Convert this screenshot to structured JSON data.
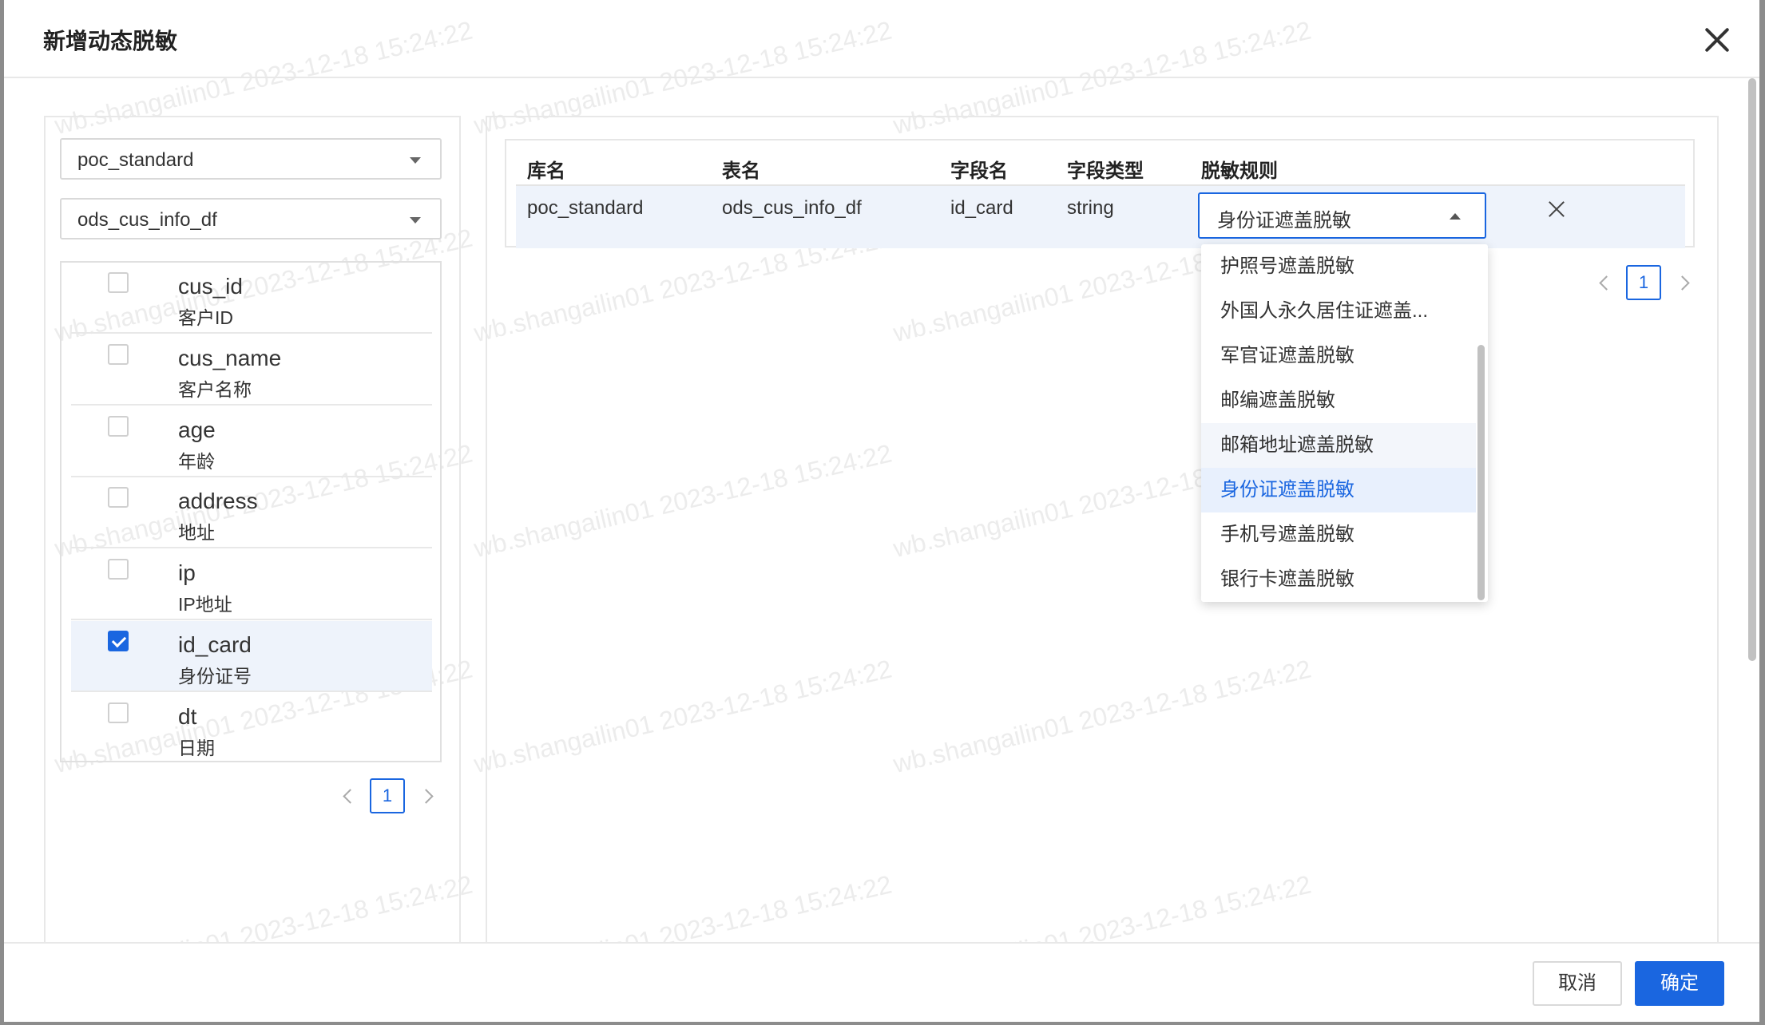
{
  "modal": {
    "title": "新增动态脱敏"
  },
  "left": {
    "database_select": "poc_standard",
    "table_select": "ods_cus_info_df",
    "fields": [
      {
        "name": "cus_id",
        "desc": "客户ID",
        "checked": false
      },
      {
        "name": "cus_name",
        "desc": "客户名称",
        "checked": false
      },
      {
        "name": "age",
        "desc": "年龄",
        "checked": false
      },
      {
        "name": "address",
        "desc": "地址",
        "checked": false
      },
      {
        "name": "ip",
        "desc": "IP地址",
        "checked": false
      },
      {
        "name": "id_card",
        "desc": "身份证号",
        "checked": true
      },
      {
        "name": "dt",
        "desc": "日期",
        "checked": false
      }
    ],
    "page": "1"
  },
  "right": {
    "columns": [
      "库名",
      "表名",
      "字段名",
      "字段类型",
      "脱敏规则"
    ],
    "row": {
      "db": "poc_standard",
      "table": "ods_cus_info_df",
      "field": "id_card",
      "type": "string",
      "rule": "身份证遮盖脱敏"
    },
    "page": "1"
  },
  "dropdown": {
    "options": [
      "护照号遮盖脱敏",
      "外国人永久居住证遮盖...",
      "军官证遮盖脱敏",
      "邮编遮盖脱敏",
      "邮箱地址遮盖脱敏",
      "身份证遮盖脱敏",
      "手机号遮盖脱敏",
      "银行卡遮盖脱敏"
    ],
    "hovered_index": 4,
    "selected_index": 5
  },
  "footer": {
    "cancel_label": "取消",
    "ok_label": "确定"
  },
  "watermark_text": "wb.shangailin01 2023-12-18 15:24:22",
  "colors": {
    "primary": "#1a66e0",
    "selected_row": "#eef3fb"
  }
}
